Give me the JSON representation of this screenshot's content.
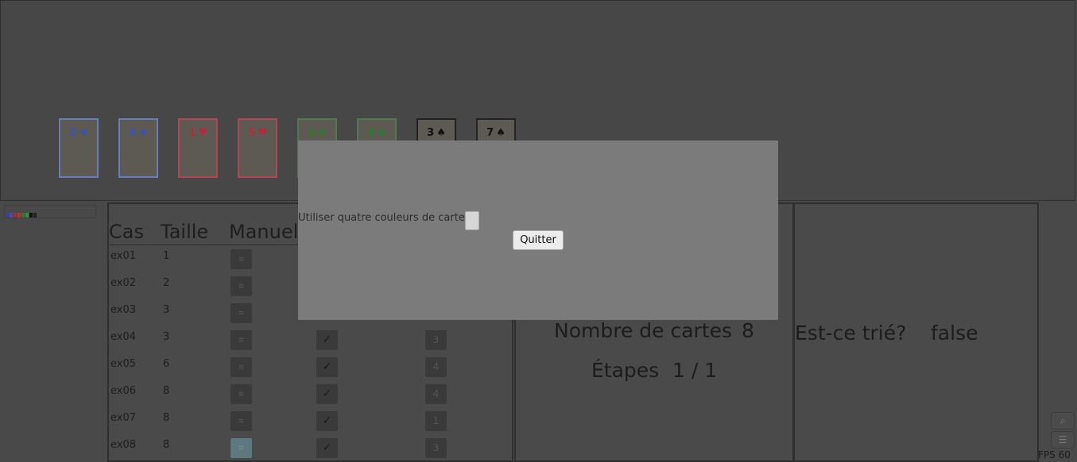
{
  "cards": [
    {
      "value": "2",
      "suit": "♦",
      "color": "#3a53b8",
      "border": "#6a7cbc"
    },
    {
      "value": "6",
      "suit": "♦",
      "color": "#3a53b8",
      "border": "#6a7cbc"
    },
    {
      "value": "1",
      "suit": "♥",
      "color": "#b8283a",
      "border": "#b24454"
    },
    {
      "value": "5",
      "suit": "♥",
      "color": "#b8283a",
      "border": "#b24454"
    },
    {
      "value": "4",
      "suit": "♣",
      "color": "#2f7a2f",
      "border": "#4e7a4e"
    },
    {
      "value": "8",
      "suit": "♣",
      "color": "#2f7a2f",
      "border": "#4e7a4e"
    },
    {
      "value": "3",
      "suit": "♠",
      "color": "#111111",
      "border": "#222222"
    },
    {
      "value": "7",
      "suit": "♠",
      "color": "#111111",
      "border": "#222222"
    }
  ],
  "palette_colors": [
    "#4040a0",
    "#4a4ab0",
    "#a03030",
    "#b03838",
    "#2f7a2f",
    "#3a8a3a",
    "#111111",
    "#222222"
  ],
  "table": {
    "headers": {
      "cas": "Cas",
      "taille": "Taille",
      "manuel": "Manuel"
    },
    "rows": [
      {
        "cas": "ex01",
        "taille": "1",
        "manual_icon": "⌗",
        "active": false,
        "check": "",
        "num": ""
      },
      {
        "cas": "ex02",
        "taille": "2",
        "manual_icon": "⌗",
        "active": false,
        "check": "",
        "num": ""
      },
      {
        "cas": "ex03",
        "taille": "3",
        "manual_icon": "⌗",
        "active": false,
        "check": "",
        "num": ""
      },
      {
        "cas": "ex04",
        "taille": "3",
        "manual_icon": "⌗",
        "active": false,
        "check": "✓",
        "num": "3"
      },
      {
        "cas": "ex05",
        "taille": "6",
        "manual_icon": "⌗",
        "active": false,
        "check": "✓",
        "num": "4"
      },
      {
        "cas": "ex06",
        "taille": "8",
        "manual_icon": "⌗",
        "active": false,
        "check": "✓",
        "num": "4"
      },
      {
        "cas": "ex07",
        "taille": "8",
        "manual_icon": "⌗",
        "active": false,
        "check": "✓",
        "num": "1"
      },
      {
        "cas": "ex08",
        "taille": "8",
        "manual_icon": "⌗",
        "active": true,
        "check": "✓",
        "num": "3"
      }
    ]
  },
  "stats": {
    "cards_label": "Nombre de cartes",
    "cards_value": "8",
    "steps_label": "Étapes",
    "steps_value": "1 / 1"
  },
  "sorted": {
    "label": "Est-ce trié?",
    "value": "false"
  },
  "dialog": {
    "checkbox_label": "Utiliser quatre couleurs de carte",
    "checkbox_checked": false,
    "quit_label": "Quitter"
  },
  "corner": {
    "search_icon": "search-icon",
    "menu_icon": "menu-icon",
    "menu_glyph": "☰",
    "search_glyph": "⌕"
  },
  "fps": "FPS 60"
}
